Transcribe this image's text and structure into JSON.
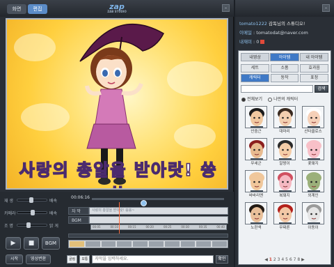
{
  "left": {
    "mode_tabs": [
      {
        "label": "화면",
        "active": false
      },
      {
        "label": "편집",
        "active": true
      }
    ],
    "logo": "zap",
    "logo_sub": "ZAB STUDIO",
    "minimize": "–",
    "subtitle_overlay": "사랑의 총알을 받아랏! 쓩쓩",
    "sliders": [
      {
        "label": "재 생",
        "end": "배속",
        "level": 0.45
      },
      {
        "label": "카메라",
        "end": "배속",
        "level": 0.5
      },
      {
        "label": "조 명",
        "end": "밝 게",
        "level": 0.35
      }
    ],
    "playback": {
      "play": "▶",
      "stop": "■",
      "bgm": "BGM"
    },
    "bottom_buttons": {
      "start": "시작",
      "save": "영상변환"
    },
    "timeline": {
      "time": "00:06:16",
      "tracks": [
        {
          "label": "자 막",
          "content": "사랑의 총알을 받아랏! 쓩쓩~"
        },
        {
          "label": "BGM",
          "content": ""
        }
      ],
      "ruler": [
        "00:05",
        "00:10",
        "00:15",
        "00:20",
        "00:25",
        "00:30",
        "00:35",
        "00:40"
      ],
      "playhead_fraction": 0.36
    },
    "subtitle_input": {
      "style1": "굴림",
      "style2": "보통",
      "placeholder": "자막을 입력하세요.",
      "ok": "확인"
    }
  },
  "right": {
    "user": {
      "id": "tomato1222",
      "greeting": "감독님의 스튜디오!",
      "email_label": "이메일",
      "email": "tomatodat@naver.com",
      "items_label": "내재미",
      "items_value": "0"
    },
    "lib_tabs": [
      {
        "label": "내영상",
        "active": false
      },
      {
        "label": "아이템",
        "active": true
      },
      {
        "label": "내 아이템",
        "active": false
      }
    ],
    "categories": [
      {
        "label": "세트",
        "active": false
      },
      {
        "label": "소품",
        "active": false
      },
      {
        "label": "효과음",
        "active": false
      },
      {
        "label": "캐릭터",
        "active": true
      },
      {
        "label": "동작",
        "active": false
      },
      {
        "label": "표정",
        "active": false
      }
    ],
    "search_button": "검색",
    "radio": [
      {
        "label": "전체보기",
        "on": true
      },
      {
        "label": "나만의 캐릭터",
        "on": false
      }
    ],
    "characters": [
      {
        "name": "안중근",
        "icon": "man-face-icon",
        "skin": "#f0c8a0",
        "hair": "#1b1b1b"
      },
      {
        "name": "대마리",
        "icon": "woman-face-icon",
        "skin": "#f3cfb0",
        "hair": "#3a2a20"
      },
      {
        "name": "산타클로스",
        "icon": "santa-face-icon",
        "skin": "#f5d0b8",
        "hair": "#ffffff"
      },
      {
        "name": "무세군",
        "icon": "soldier-face-icon",
        "skin": "#e8bb90",
        "hair": "#8b1d1d"
      },
      {
        "name": "알왕이",
        "icon": "kid-face-icon",
        "skin": "#f5cda8",
        "hair": "#2a2a2a"
      },
      {
        "name": "꽃돼지",
        "icon": "pig-face-icon",
        "skin": "#f8c0c8",
        "hair": "#f8c0c8"
      },
      {
        "name": "바바리맨",
        "icon": "bald-face-icon",
        "skin": "#f0c79b",
        "hair": "#f0c79b"
      },
      {
        "name": "복돼지",
        "icon": "lucky-pig-icon",
        "skin": "#f5b9c2",
        "hair": "#d05060"
      },
      {
        "name": "외계인",
        "icon": "alien-face-icon",
        "skin": "#9bb07a",
        "hair": "#9bb07a"
      },
      {
        "name": "노란색",
        "icon": "boy-face-icon",
        "skin": "#e9c09a",
        "hair": "#221a14"
      },
      {
        "name": "무찌른",
        "icon": "redhair-face-icon",
        "skin": "#f2c8a6",
        "hair": "#b3201a"
      },
      {
        "name": "이동이",
        "icon": "bear-face-icon",
        "skin": "#e5e5e5",
        "hair": "#9a9a9a"
      }
    ],
    "pager": {
      "prev": "◀",
      "current": "1",
      "pages": [
        "2",
        "3",
        "4",
        "5",
        "6",
        "7",
        "8"
      ],
      "next": "▶"
    }
  }
}
